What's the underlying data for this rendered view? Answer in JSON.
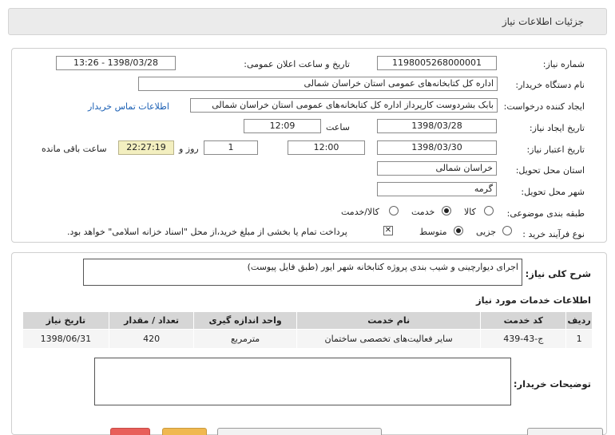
{
  "panel": {
    "title": "جزئیات اطلاعات نیاز"
  },
  "labels": {
    "need_number": "شماره نیاز:",
    "announce_datetime": "تاریخ و ساعت اعلان عمومی:",
    "buyer_org": "نام دستگاه خریدار:",
    "requester": "ایجاد کننده درخواست:",
    "need_created_date": "تاریخ ایجاد نیاز:",
    "time_word": "ساعت",
    "need_valid_date": "تاریخ اعتبار نیاز:",
    "day_and": "روز و",
    "remaining": "ساعت باقی مانده",
    "delivery_province": "استان محل تحویل:",
    "delivery_city": "شهر محل تحویل:",
    "category": "طبقه بندی موضوعی:",
    "purchase_type": "نوع فرآیند خرید :",
    "general_desc": "شرح کلی نیاز:",
    "services_info": "اطلاعات خدمات مورد نیاز",
    "buyer_notes": "توضیحات خریدار:"
  },
  "values": {
    "need_number": "1198005268000001",
    "announce_datetime": "1398/03/28 - 13:26",
    "buyer_org": "اداره کل کتابخانه‌های عمومی استان خراسان شمالی",
    "requester": "بابک  بشردوست کارپرداز  اداره کل کتابخانه‌های عمومی استان خراسان شمالی",
    "contact_link": "اطلاعات تماس خریدار",
    "created_date": "1398/03/28",
    "created_time": "12:09",
    "valid_date": "1398/03/30",
    "valid_time": "12:00",
    "days": "1",
    "remaining_time": "22:27:19",
    "province": "خراسان شمالی",
    "city": "گرمه",
    "general_desc": "اجرای دیوارچینی و شیب بندی پروژه کتابخانه شهر ایور (طبق فایل پیوست)"
  },
  "category_options": [
    {
      "label": "کالا",
      "selected": false
    },
    {
      "label": "خدمت",
      "selected": true
    },
    {
      "label": "کالا/خدمت",
      "selected": false
    }
  ],
  "purchase_options": [
    {
      "label": "جزیی",
      "selected": false
    },
    {
      "label": "متوسط",
      "selected": true
    }
  ],
  "payment_note": "پرداخت تمام یا بخشی از مبلغ خرید،از محل \"اسناد خزانه اسلامی\" خواهد بود.",
  "table": {
    "headers": [
      "ردیف",
      "کد خدمت",
      "نام خدمت",
      "واحد اندازه گیری",
      "تعداد / مقدار",
      "تاریخ نیاز"
    ],
    "rows": [
      [
        "1",
        "ج-43-439",
        "سایر فعالیت‌های تخصصی ساختمان",
        "مترمربع",
        "420",
        "1398/06/31"
      ]
    ]
  },
  "colors": {
    "panel_bg": "#ebebeb",
    "link": "#1a5fb4",
    "table_header": "#d6d6d6",
    "remaining_bg": "#f3efc0"
  }
}
